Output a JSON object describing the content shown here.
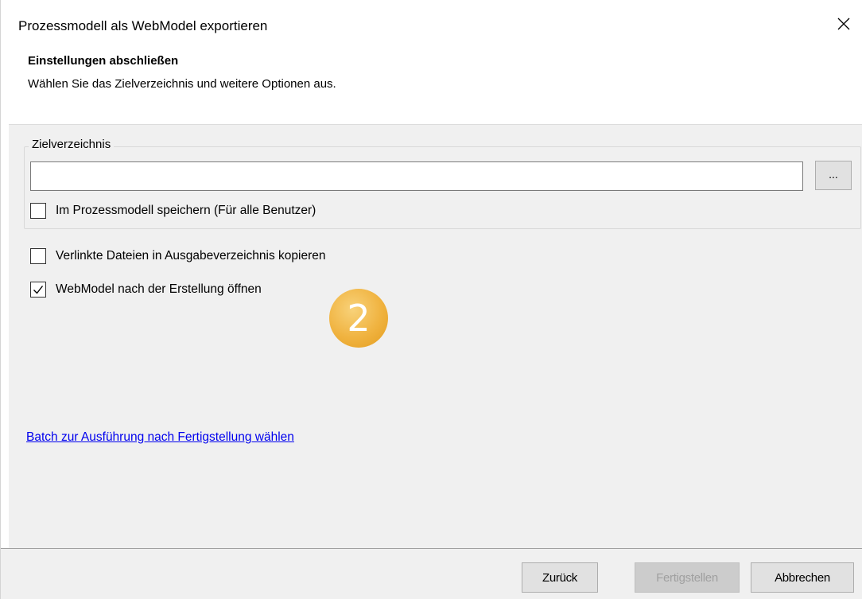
{
  "window": {
    "title": "Prozessmodell als WebModel exportieren",
    "close_icon": "close-icon"
  },
  "header": {
    "title": "Einstellungen abschließen",
    "subtitle": "Wählen Sie das Zielverzeichnis und weitere Optionen aus."
  },
  "target_group": {
    "legend": "Zielverzeichnis",
    "path_value": "",
    "browse_label": "...",
    "save_in_model": {
      "label": "Im Prozessmodell speichern (Für alle Benutzer)",
      "checked": false
    }
  },
  "options": {
    "copy_linked": {
      "label": "Verlinkte Dateien in Ausgabeverzeichnis kopieren",
      "checked": false
    },
    "open_after": {
      "label": "WebModel nach der Erstellung öffnen",
      "checked": true
    }
  },
  "annotation": {
    "number": "2",
    "color": "#f0b340"
  },
  "batch_link": "Batch zur Ausführung nach Fertigstellung wählen",
  "footer": {
    "back_label": "Zurück",
    "finish_label": "Fertigstellen",
    "cancel_label": "Abbrechen"
  }
}
